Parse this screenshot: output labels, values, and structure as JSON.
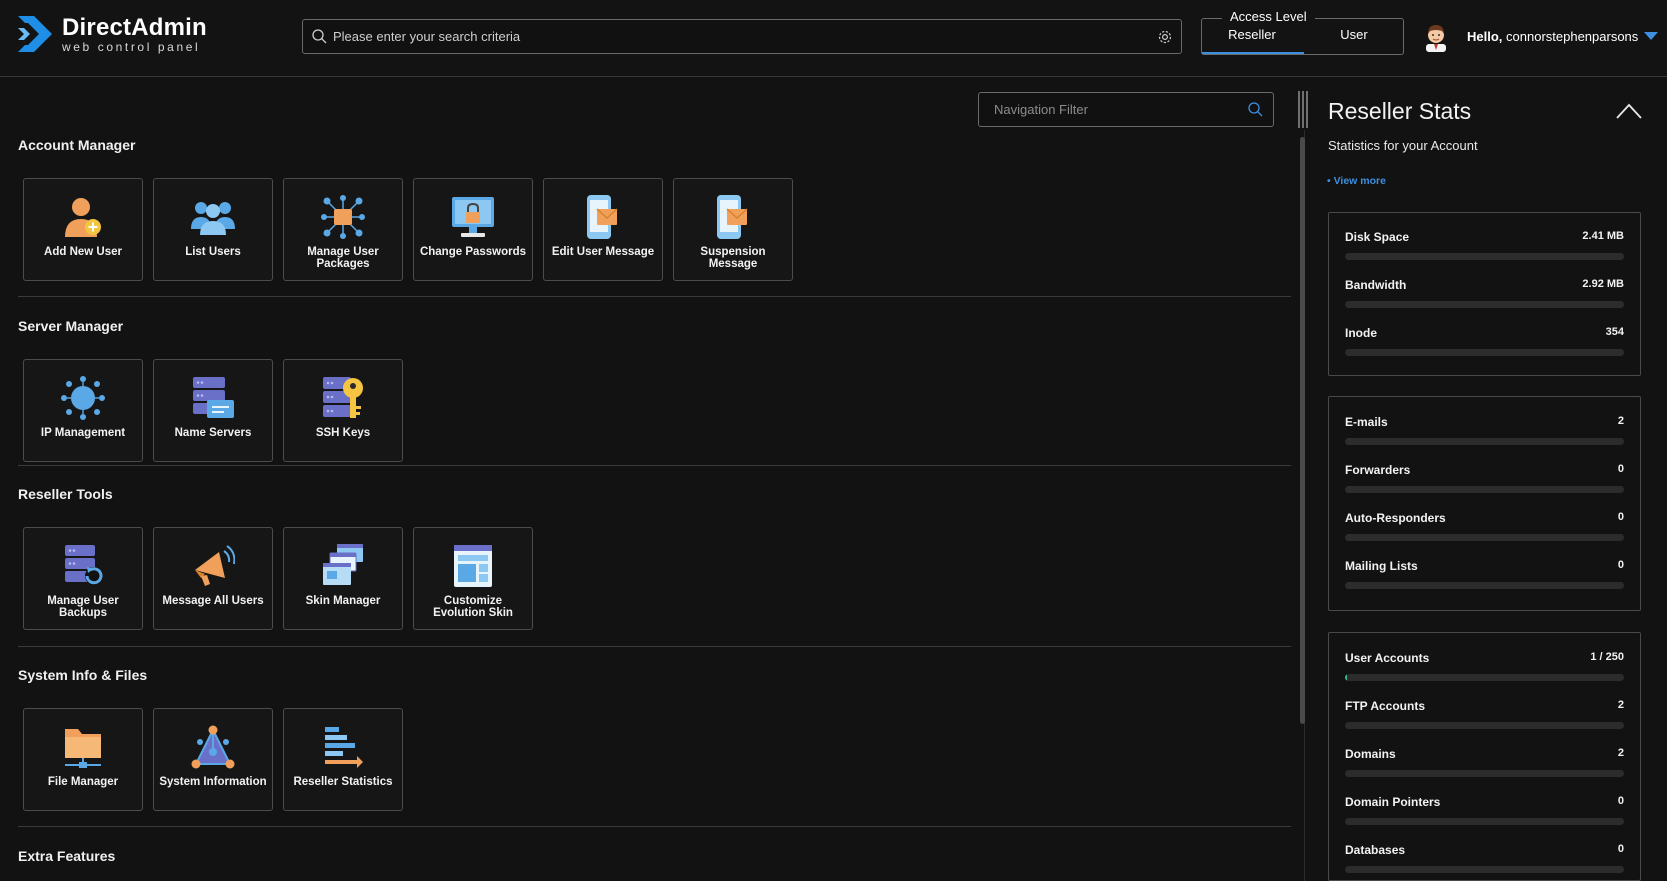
{
  "header": {
    "logo_title": "DirectAdmin",
    "logo_subtitle": "web control panel",
    "search_placeholder": "Please enter your search criteria",
    "access_level_label": "Access Level",
    "access_options": [
      "Reseller",
      "User"
    ],
    "access_selected": "Reseller",
    "greeting": "Hello,",
    "username": "connorstephenparsons"
  },
  "main": {
    "nav_filter_placeholder": "Navigation Filter",
    "sections": [
      {
        "title": "Account Manager",
        "tiles": [
          {
            "label": "Add New User",
            "icon": "add-user-icon"
          },
          {
            "label": "List Users",
            "icon": "users-icon"
          },
          {
            "label": "Manage User Packages",
            "icon": "packages-icon"
          },
          {
            "label": "Change Passwords",
            "icon": "monitor-lock-icon"
          },
          {
            "label": "Edit User Message",
            "icon": "phone-message-icon"
          },
          {
            "label": "Suspension Message",
            "icon": "phone-message-icon"
          }
        ]
      },
      {
        "title": "Server Manager",
        "tiles": [
          {
            "label": "IP Management",
            "icon": "network-globe-icon"
          },
          {
            "label": "Name Servers",
            "icon": "server-card-icon"
          },
          {
            "label": "SSH Keys",
            "icon": "server-key-icon"
          }
        ]
      },
      {
        "title": "Reseller Tools",
        "tiles": [
          {
            "label": "Manage User Backups",
            "icon": "server-backup-icon"
          },
          {
            "label": "Message All Users",
            "icon": "megaphone-icon"
          },
          {
            "label": "Skin Manager",
            "icon": "windows-stack-icon"
          },
          {
            "label": "Customize Evolution Skin",
            "icon": "layout-icon"
          }
        ]
      },
      {
        "title": "System Info & Files",
        "tiles": [
          {
            "label": "File Manager",
            "icon": "folder-network-icon"
          },
          {
            "label": "System Information",
            "icon": "triangle-nodes-icon"
          },
          {
            "label": "Reseller Statistics",
            "icon": "bar-stats-icon"
          }
        ]
      },
      {
        "title": "Extra Features",
        "tiles": []
      }
    ]
  },
  "reseller_stats": {
    "title": "Reseller Stats",
    "subtitle": "Statistics for your Account",
    "view_more": "• View more",
    "groups": [
      [
        {
          "name": "Disk Space",
          "value": "2.41 MB",
          "fraction": 0
        },
        {
          "name": "Bandwidth",
          "value": "2.92 MB",
          "fraction": 0
        },
        {
          "name": "Inode",
          "value": "354",
          "fraction": 0
        }
      ],
      [
        {
          "name": "E-mails",
          "value": "2",
          "fraction": 0
        },
        {
          "name": "Forwarders",
          "value": "0",
          "fraction": 0
        },
        {
          "name": "Auto-Responders",
          "value": "0",
          "fraction": 0
        },
        {
          "name": "Mailing Lists",
          "value": "0",
          "fraction": 0
        }
      ],
      [
        {
          "name": "User Accounts",
          "value": "1 / 250",
          "fraction": 0.004
        },
        {
          "name": "FTP Accounts",
          "value": "2",
          "fraction": 0
        },
        {
          "name": "Domains",
          "value": "2",
          "fraction": 0
        },
        {
          "name": "Domain Pointers",
          "value": "0",
          "fraction": 0
        },
        {
          "name": "Databases",
          "value": "0",
          "fraction": 0
        }
      ]
    ]
  },
  "colors": {
    "accent": "#3d8fe0",
    "background": "#121212",
    "bar_fill": "#3fb58a"
  }
}
